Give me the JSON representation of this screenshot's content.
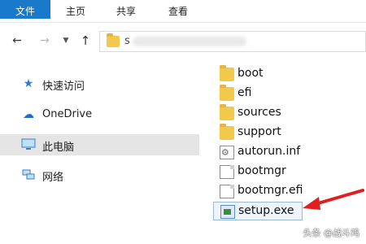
{
  "ribbon": {
    "tabs": [
      "文件",
      "主页",
      "共享",
      "查看"
    ]
  },
  "address": {
    "text": "s"
  },
  "navpane": {
    "items": [
      {
        "label": "快速访问",
        "icon": "star-icon"
      },
      {
        "label": "OneDrive",
        "icon": "cloud-icon"
      },
      {
        "label": "此电脑",
        "icon": "computer-icon"
      },
      {
        "label": "网络",
        "icon": "network-icon"
      }
    ]
  },
  "files": [
    {
      "name": "boot",
      "type": "folder"
    },
    {
      "name": "efi",
      "type": "folder"
    },
    {
      "name": "sources",
      "type": "folder"
    },
    {
      "name": "support",
      "type": "folder"
    },
    {
      "name": "autorun.inf",
      "type": "config"
    },
    {
      "name": "bootmgr",
      "type": "file"
    },
    {
      "name": "bootmgr.efi",
      "type": "file"
    },
    {
      "name": "setup.exe",
      "type": "exe"
    }
  ],
  "watermark": "头条 @战斗鸡",
  "colors": {
    "file_tab": "#1979ca",
    "folder": "#f2c94c",
    "arrow": "#e02020",
    "selected_nav": "#e5e5e5"
  }
}
